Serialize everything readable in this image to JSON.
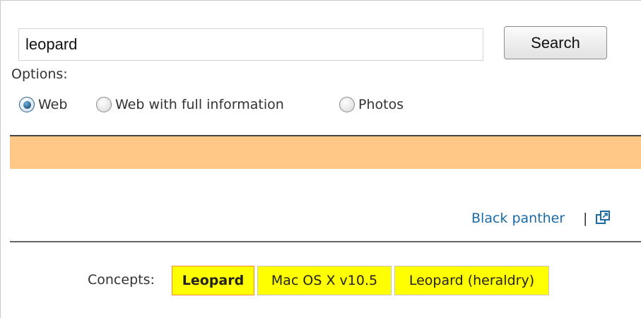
{
  "search": {
    "query": "leopard",
    "button_label": "Search"
  },
  "options": {
    "label": "Options:",
    "choices": [
      {
        "label": "Web",
        "checked": true
      },
      {
        "label": "Web with full information",
        "checked": false
      },
      {
        "label": "Photos",
        "checked": false
      }
    ]
  },
  "colors": {
    "band": "#ffc887",
    "concept_highlight": "#ffff00",
    "link": "#1a6aa8"
  },
  "related": {
    "link_text": "Black panther",
    "separator": "|",
    "icon": "external-link-icon"
  },
  "concepts": {
    "label": "Concepts:",
    "items": [
      {
        "label": "Leopard",
        "active": true
      },
      {
        "label": "Mac OS X v10.5",
        "active": false
      },
      {
        "label": "Leopard (heraldry)",
        "active": false
      }
    ]
  }
}
